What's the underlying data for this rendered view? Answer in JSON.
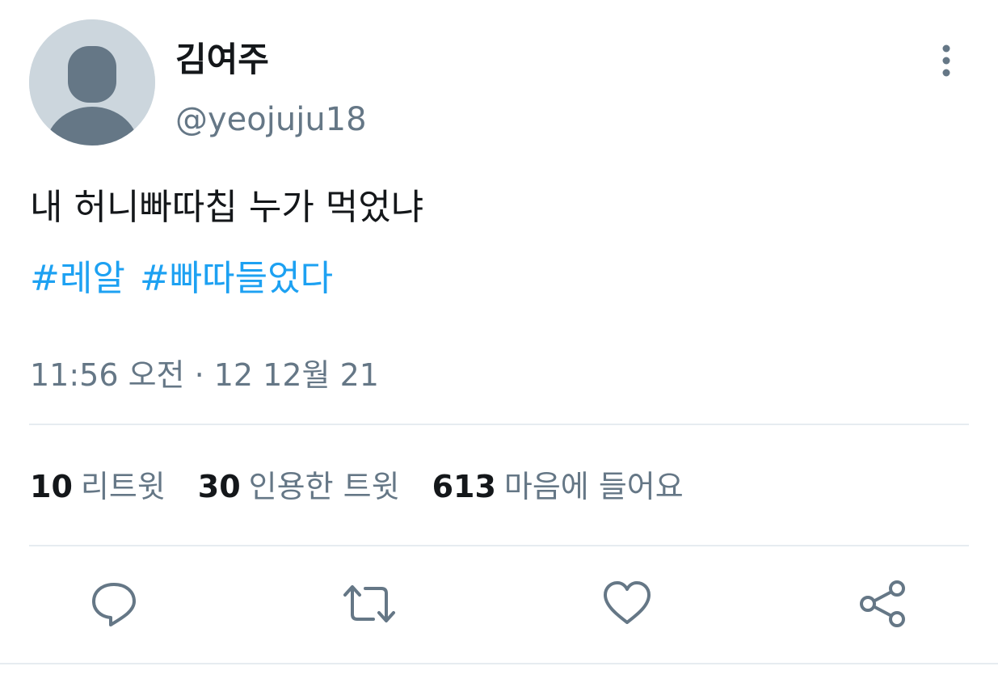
{
  "user": {
    "display_name": "김여주",
    "handle": "@yeojuju18"
  },
  "tweet": {
    "text": "내 허니빠따칩 누가 먹었냐",
    "hashtags": [
      "#레알",
      "#빠따들었다"
    ],
    "timestamp": "11:56 오전 · 12 12월 21"
  },
  "stats": {
    "retweets": {
      "count": "10",
      "label": "리트윗"
    },
    "quotes": {
      "count": "30",
      "label": "인용한 트윗"
    },
    "likes": {
      "count": "613",
      "label": "마음에 들어요"
    }
  },
  "icons": {
    "more": "more-vertical-icon",
    "reply": "reply-icon",
    "retweet": "retweet-icon",
    "like": "heart-icon",
    "share": "share-icon"
  },
  "colors": {
    "hashtag": "#1da1f2",
    "secondary_text": "#657786",
    "primary_text": "#14171a",
    "icon": "#657786",
    "divider": "#e6ecf0",
    "avatar_bg": "#ccd6dd",
    "avatar_fg": "#657786"
  }
}
